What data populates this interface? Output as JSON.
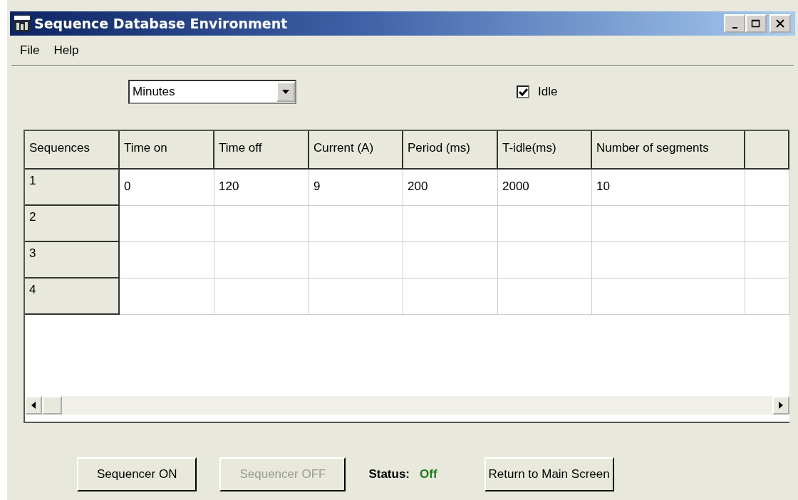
{
  "window": {
    "title": "Sequence Database Environment"
  },
  "menu": [
    "File",
    "Help"
  ],
  "units_dropdown": {
    "value": "Minutes"
  },
  "idle_checkbox": {
    "label": "Idle",
    "checked": true
  },
  "table": {
    "corner": "Sequences",
    "columns": [
      "Time on",
      "Time off",
      "Current (A)",
      "Period (ms)",
      "T-idle(ms)",
      "Number of segments"
    ],
    "rows": [
      {
        "label": "1",
        "cells": [
          "0",
          "120",
          "9",
          "200",
          "2000",
          "10"
        ]
      },
      {
        "label": "2",
        "cells": []
      },
      {
        "label": "3",
        "cells": []
      },
      {
        "label": "4",
        "cells": []
      }
    ]
  },
  "footer": [
    {
      "kind": "button",
      "label": "Sequencer ON",
      "disabled": false
    },
    {
      "kind": "button",
      "label": "Sequencer OFF",
      "disabled": true
    },
    {
      "kind": "status",
      "label": "Status:",
      "value": "Off"
    },
    {
      "kind": "button",
      "label": "Return to Main Screen",
      "disabled": false
    }
  ]
}
